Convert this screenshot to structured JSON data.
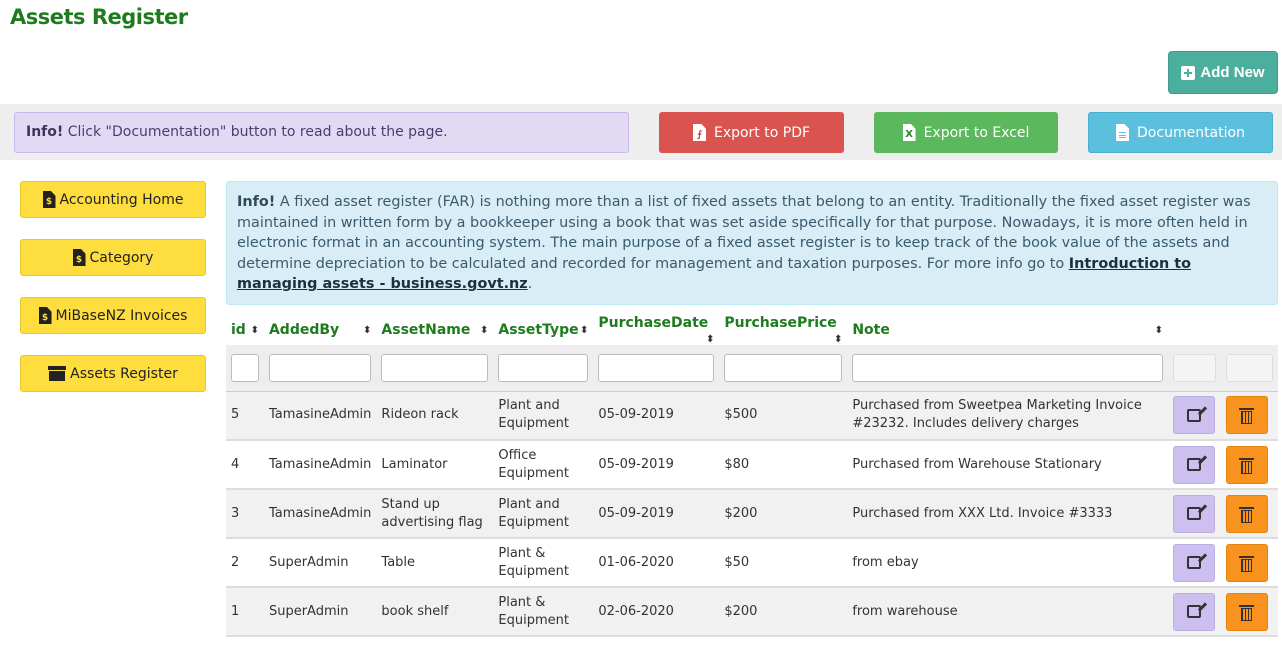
{
  "page": {
    "title": "Assets Register"
  },
  "header": {
    "add_new_label": "Add New"
  },
  "toolbar": {
    "info_bold": "Info!",
    "info_text": " Click \"Documentation\" button to read about the page.",
    "export_pdf_label": "Export to PDF",
    "export_excel_label": "Export to Excel",
    "documentation_label": "Documentation"
  },
  "sidebar": {
    "items": [
      {
        "label": "Accounting Home",
        "icon": "file-invoice-dollar-icon"
      },
      {
        "label": "Category",
        "icon": "file-invoice-dollar-icon"
      },
      {
        "label": "MiBaseNZ Invoices",
        "icon": "file-invoice-dollar-icon"
      },
      {
        "label": "Assets Register",
        "icon": "archive-icon"
      }
    ]
  },
  "info_panel": {
    "bold": "Info!",
    "text": " A fixed asset register (FAR) is nothing more than a list of fixed assets that belong to an entity. Traditionally the fixed asset register was maintained in written form by a bookkeeper using a book that was set aside specifically for that purpose. Nowadays, it is more often held in electronic format in an accounting system. The main purpose of a fixed asset register is to keep track of the book value of the assets and determine depreciation to be calculated and recorded for management and taxation purposes. For more info go to ",
    "link_text": "Introduction to managing assets - business.govt.nz",
    "suffix": "."
  },
  "table": {
    "columns": [
      "id",
      "AddedBy",
      "AssetName",
      "AssetType",
      "PurchaseDate",
      "PurchasePrice",
      "Note"
    ],
    "rows": [
      {
        "id": "5",
        "added_by": "TamasineAdmin",
        "asset_name": "Rideon rack",
        "asset_type": "Plant and Equipment",
        "purchase_date": "05-09-2019",
        "purchase_price": "$500",
        "note": "Purchased from Sweetpea Marketing Invoice #23232. Includes delivery charges"
      },
      {
        "id": "4",
        "added_by": "TamasineAdmin",
        "asset_name": "Laminator",
        "asset_type": "Office Equipment",
        "purchase_date": "05-09-2019",
        "purchase_price": "$80",
        "note": "Purchased from Warehouse Stationary"
      },
      {
        "id": "3",
        "added_by": "TamasineAdmin",
        "asset_name": "Stand up advertising flag",
        "asset_type": "Plant and Equipment",
        "purchase_date": "05-09-2019",
        "purchase_price": "$200",
        "note": "Purchased from XXX Ltd. Invoice #3333"
      },
      {
        "id": "2",
        "added_by": "SuperAdmin",
        "asset_name": "Table",
        "asset_type": "Plant & Equipment",
        "purchase_date": "01-06-2020",
        "purchase_price": "$50",
        "note": "from ebay"
      },
      {
        "id": "1",
        "added_by": "SuperAdmin",
        "asset_name": "book shelf",
        "asset_type": "Plant & Equipment",
        "purchase_date": "02-06-2020",
        "purchase_price": "$200",
        "note": "from warehouse"
      }
    ]
  },
  "colors": {
    "title_green": "#1e7b1e",
    "add_new": "#4cae9c",
    "pdf": "#d9534f",
    "excel": "#5cb85c",
    "documentation": "#5bc0de",
    "sidebar_button": "#fedd3f",
    "edit_button": "#cdbff0",
    "delete_button": "#f7931e"
  }
}
